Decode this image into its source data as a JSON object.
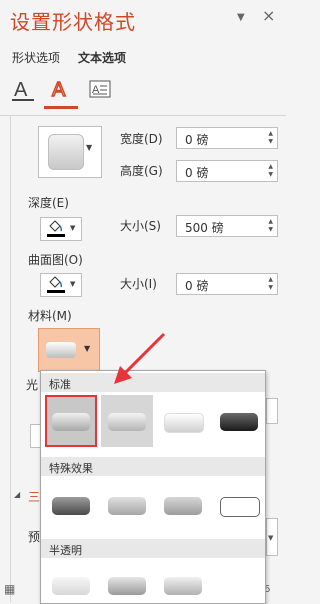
{
  "panel": {
    "title": "设置形状格式",
    "dropdown_glyph": "▼",
    "close_glyph": "×",
    "tabs": [
      {
        "label": "形状选项",
        "active": false
      },
      {
        "label": "文本选项",
        "active": true
      }
    ],
    "category_icons": [
      "text-fill-outline-icon",
      "text-effects-icon",
      "textbox-icon"
    ]
  },
  "bevel": {
    "width_label": "宽度(D)",
    "width_value": "0 磅",
    "height_label": "高度(G)",
    "height_value": "0 磅"
  },
  "depth": {
    "label": "深度(E)",
    "size_label": "大小(S)",
    "size_value": "500 磅"
  },
  "contour": {
    "label": "曲面图(O)",
    "size_label": "大小(I)",
    "size_value": "0 磅"
  },
  "material": {
    "label": "材料(M)"
  },
  "obscured": {
    "light_partial": "光",
    "section3_partial": "三",
    "preset_partial": "预",
    "percent_partial": "6"
  },
  "material_popup": {
    "sections": [
      {
        "name": "标准",
        "items": [
          "matte-material-icon",
          "warm-matte-material-icon",
          "plastic-material-icon",
          "metal-material-icon"
        ]
      },
      {
        "name": "特殊效果",
        "items": [
          "dark-edge-material-icon",
          "soft-edge-material-icon",
          "flat-material-icon",
          "wireframe-material-icon"
        ]
      },
      {
        "name": "半透明",
        "items": [
          "powder-material-icon",
          "clear-material-icon",
          "translucent-powder-material-icon"
        ]
      }
    ],
    "selected_index": 0
  },
  "colors": {
    "accent": "#d24726",
    "highlight_frame": "#e8333c",
    "material_button": "#f7c6a6"
  }
}
